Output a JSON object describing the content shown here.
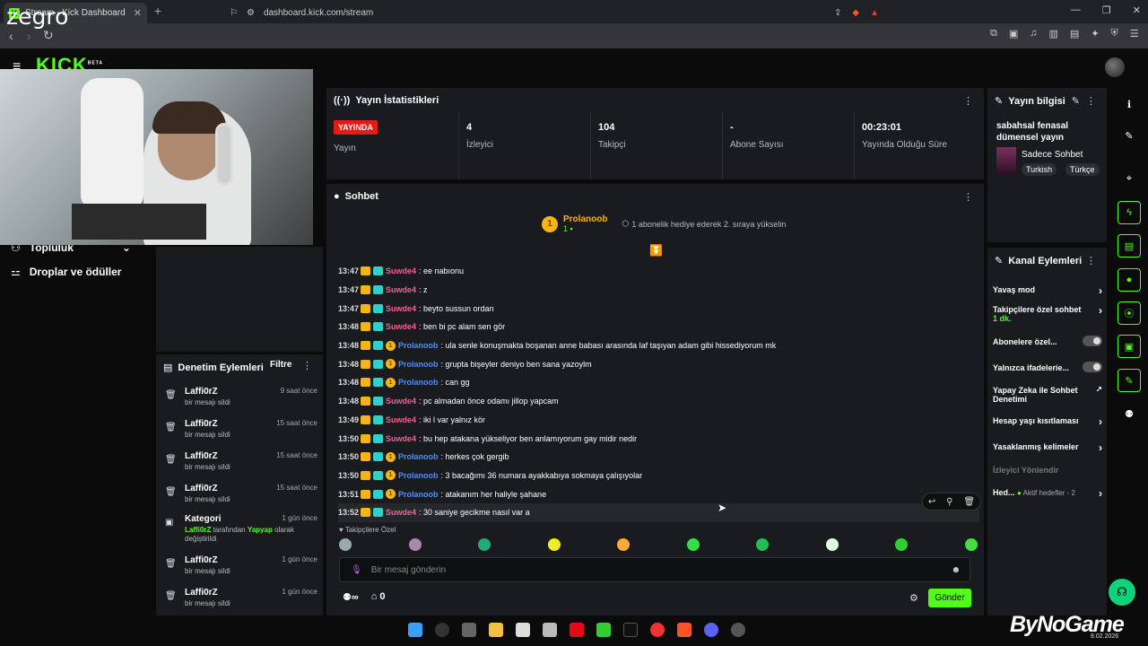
{
  "browser": {
    "tab_title": "Stream - Kick Dashboard",
    "url": "dashboard.kick.com/stream"
  },
  "webcam": {
    "overlay_name": "zegro"
  },
  "logo": {
    "text": "KICK",
    "sup": "BETA"
  },
  "left_nav": {
    "items": [
      {
        "label": "Topluluk",
        "icon": "people-icon"
      },
      {
        "label": "Droplar ve ödüller",
        "icon": "gift-icon"
      }
    ]
  },
  "stats_panel": {
    "title": "Yayın İstatistikleri",
    "live_badge": "YAYINDA",
    "live_label": "Yayın",
    "stats": [
      {
        "value": "4",
        "label": "İzleyici"
      },
      {
        "value": "104",
        "label": "Takipçi"
      },
      {
        "value": "-",
        "label": "Abone Sayısı"
      },
      {
        "value": "00:23:01",
        "label": "Yayında Olduğu Süre"
      }
    ]
  },
  "chat": {
    "title": "Sohbet",
    "pinned": {
      "rank": "1",
      "user": "Prolanoob",
      "subs": "1",
      "message": "1 abonelik hediye ederek 2. sıraya yükselin"
    },
    "messages": [
      {
        "time": "13:47",
        "user": "Suwde4",
        "color": "#f06292",
        "text": ": ee nabıonu",
        "gift": false
      },
      {
        "time": "13:47",
        "user": "Suwde4",
        "color": "#f06292",
        "text": ": z",
        "gift": false
      },
      {
        "time": "13:47",
        "user": "Suwde4",
        "color": "#f06292",
        "text": ": beyto sussun ordan",
        "gift": false
      },
      {
        "time": "13:48",
        "user": "Suwde4",
        "color": "#f06292",
        "text": ": ben bi pc alam sen gör",
        "gift": false
      },
      {
        "time": "13:48",
        "user": "Prolanoob",
        "color": "#4f8ef7",
        "text": ": ula senle konuşmakta boşanan anne babası arasında laf taşıyan adam gibi hissediyorum mk",
        "gift": true
      },
      {
        "time": "13:48",
        "user": "Prolanoob",
        "color": "#4f8ef7",
        "text": ": grupta bişeyler deniyo ben sana yazoylm",
        "gift": true
      },
      {
        "time": "13:48",
        "user": "Prolanoob",
        "color": "#4f8ef7",
        "text": ": can gg",
        "gift": true
      },
      {
        "time": "13:48",
        "user": "Suwde4",
        "color": "#f06292",
        "text": ": pc almadan önce odamı jillop yapcam",
        "gift": false
      },
      {
        "time": "13:49",
        "user": "Suwde4",
        "color": "#f06292",
        "text": ": iki l var yalnız kör",
        "gift": false
      },
      {
        "time": "13:50",
        "user": "Suwde4",
        "color": "#f06292",
        "text": ": bu hep atakana yükseliyor ben anlamıyorum gay midir nedir",
        "gift": false
      },
      {
        "time": "13:50",
        "user": "Prolanoob",
        "color": "#4f8ef7",
        "text": ": herkes çok gergib",
        "gift": true
      },
      {
        "time": "13:50",
        "user": "Prolanoob",
        "color": "#4f8ef7",
        "text": ": 3 bacağımı 36 numara ayakkabıya sokmaya çalışıyolar",
        "gift": true
      },
      {
        "time": "13:51",
        "user": "Prolanoob",
        "color": "#4f8ef7",
        "text": ": atakanım her haliyle şahane",
        "gift": true
      },
      {
        "time": "13:52",
        "user": "Suwde4",
        "color": "#f06292",
        "text": ": 30 saniye gecikme nasıl var a",
        "gift": false
      }
    ],
    "emote_section_label": "Takipçilere Özel",
    "input_placeholder": "Bir mesaj gönderin",
    "points": "0",
    "send_label": "Gönder"
  },
  "moderation": {
    "title": "Denetim Eylemleri",
    "filter_label": "Filtre",
    "items": [
      {
        "user": "Laffi0rZ",
        "time": "9 saat önce",
        "desc": "bir mesajı sildi",
        "icon": "trash-icon"
      },
      {
        "user": "Laffi0rZ",
        "time": "15 saat önce",
        "desc": "bir mesajı sildi",
        "icon": "trash-icon"
      },
      {
        "user": "Laffi0rZ",
        "time": "15 saat önce",
        "desc": "bir mesajı sildi",
        "icon": "trash-icon"
      },
      {
        "user": "Laffi0rZ",
        "time": "15 saat önce",
        "desc": "bir mesajı sildi",
        "icon": "trash-icon"
      },
      {
        "user": "Kategori",
        "time": "1 gün önce",
        "desc_actor": "Laffi0rZ",
        "desc_mid": " tarafından ",
        "desc_target": "Yapyap",
        "desc_end": " olarak değiştirildi",
        "icon": "category-icon"
      },
      {
        "user": "Laffi0rZ",
        "time": "1 gün önce",
        "desc": "bir mesajı sildi",
        "icon": "trash-icon"
      },
      {
        "user": "Laffi0rZ",
        "time": "1 gün önce",
        "desc": "bir mesajı sildi",
        "icon": "trash-icon"
      }
    ]
  },
  "stream_info": {
    "title": "Yayın bilgisi",
    "stream_title": "sabahsal fenasal dümensel yayın",
    "category": "Sadece Sohbet",
    "tags": [
      "Turkish",
      "Türkçe"
    ]
  },
  "channel_actions": {
    "title": "Kanal Eylemleri",
    "items": [
      {
        "label": "Yavaş mod",
        "kind": "chevron"
      },
      {
        "label": "Takipçilere özel sohbet",
        "sub": "1 dk.",
        "kind": "chevron"
      },
      {
        "label": "Abonelere özel...",
        "kind": "toggle"
      },
      {
        "label": "Yalnızca ifadelerie...",
        "kind": "toggle"
      },
      {
        "label": "Yapay Zeka ile Sohbet Denetimi",
        "kind": "external"
      },
      {
        "label": "Hesap yaşı kısıtlaması",
        "kind": "chevron"
      },
      {
        "label": "Yasaklanmış kelimeler",
        "kind": "chevron"
      },
      {
        "label": "İzleyici Yönlendir",
        "kind": "disabled"
      },
      {
        "label": "Hed...",
        "extra": "Aktif hedefler - 2",
        "kind": "chevron"
      }
    ]
  },
  "watermark": {
    "brand": "ByNoGame",
    "date": "8.02.2026"
  },
  "colors": {
    "accent": "#53fc18",
    "live": "#e91916",
    "gift": "#f5b516"
  }
}
